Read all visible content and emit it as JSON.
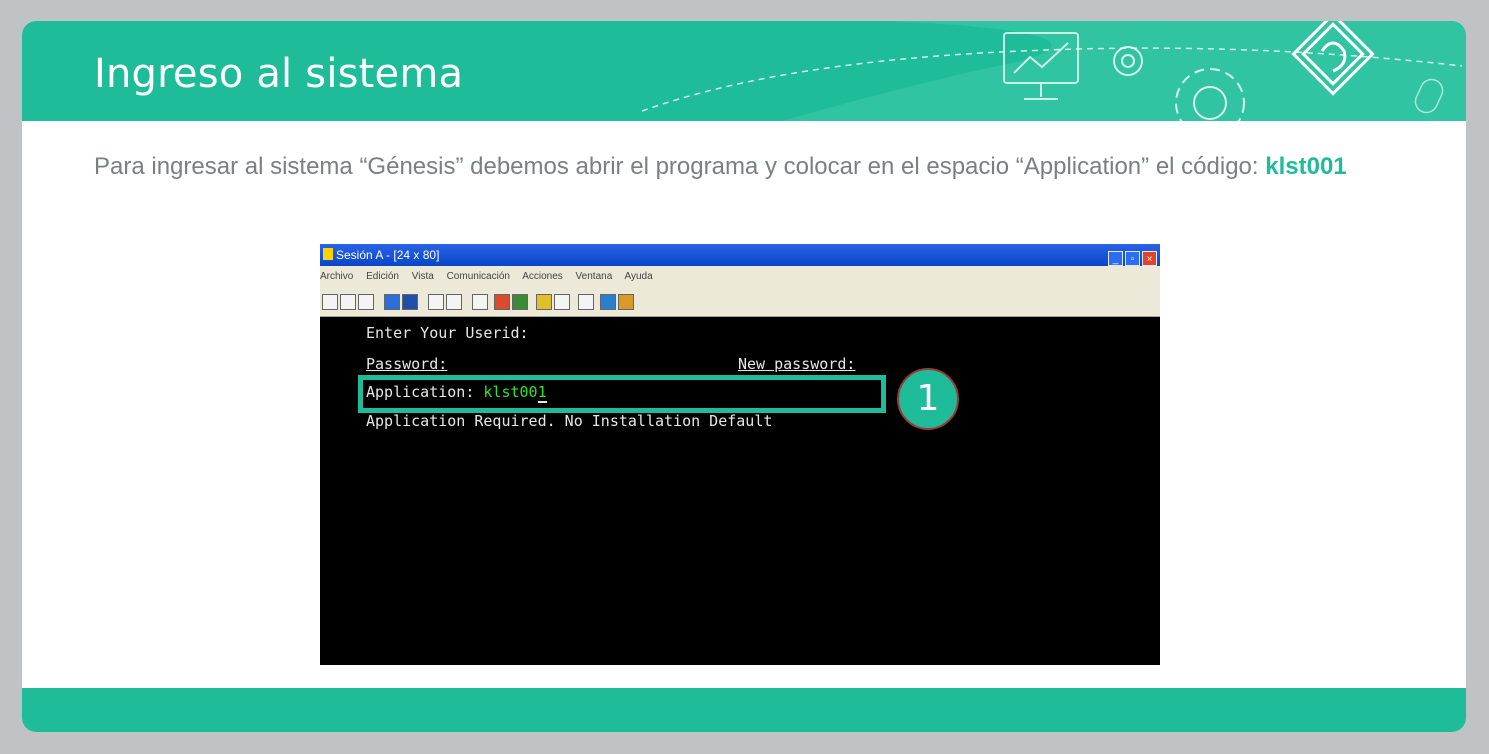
{
  "slide": {
    "title": "Ingreso al sistema",
    "intro_text": "Para ingresar al sistema “Génesis” debemos abrir el programa y colocar en el espacio “Application” el código:",
    "intro_code": "klst001",
    "callout_number": "1"
  },
  "terminal": {
    "window_title": "Sesión A - [24 x 80]",
    "menu_items": [
      "Archivo",
      "Edición",
      "Vista",
      "Comunicación",
      "Acciones",
      "Ventana",
      "Ayuda"
    ],
    "window_buttons": {
      "minimize": "_",
      "maximize": "▫",
      "close": "×"
    },
    "lines": {
      "userid_label": "Enter Your Userid:",
      "password_label": "Password:",
      "new_password_label": "New password:",
      "application_label": "Application:",
      "application_value": "klst00",
      "application_cursor": "1",
      "message": "Application Required. No Installation Default"
    }
  },
  "colors": {
    "accent": "#1fbc9a",
    "background": "#bfc3c6",
    "body_text": "#7b7f82",
    "terminal_green": "#2ce52c"
  }
}
